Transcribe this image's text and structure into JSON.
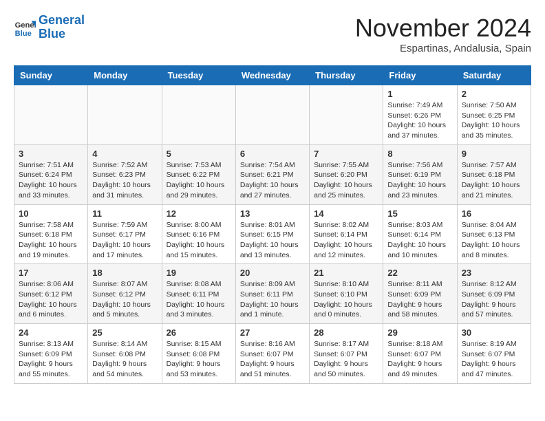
{
  "header": {
    "logo_line1": "General",
    "logo_line2": "Blue",
    "month": "November 2024",
    "location": "Espartinas, Andalusia, Spain"
  },
  "days_of_week": [
    "Sunday",
    "Monday",
    "Tuesday",
    "Wednesday",
    "Thursday",
    "Friday",
    "Saturday"
  ],
  "weeks": [
    [
      {
        "day": "",
        "info": ""
      },
      {
        "day": "",
        "info": ""
      },
      {
        "day": "",
        "info": ""
      },
      {
        "day": "",
        "info": ""
      },
      {
        "day": "",
        "info": ""
      },
      {
        "day": "1",
        "info": "Sunrise: 7:49 AM\nSunset: 6:26 PM\nDaylight: 10 hours and 37 minutes."
      },
      {
        "day": "2",
        "info": "Sunrise: 7:50 AM\nSunset: 6:25 PM\nDaylight: 10 hours and 35 minutes."
      }
    ],
    [
      {
        "day": "3",
        "info": "Sunrise: 7:51 AM\nSunset: 6:24 PM\nDaylight: 10 hours and 33 minutes."
      },
      {
        "day": "4",
        "info": "Sunrise: 7:52 AM\nSunset: 6:23 PM\nDaylight: 10 hours and 31 minutes."
      },
      {
        "day": "5",
        "info": "Sunrise: 7:53 AM\nSunset: 6:22 PM\nDaylight: 10 hours and 29 minutes."
      },
      {
        "day": "6",
        "info": "Sunrise: 7:54 AM\nSunset: 6:21 PM\nDaylight: 10 hours and 27 minutes."
      },
      {
        "day": "7",
        "info": "Sunrise: 7:55 AM\nSunset: 6:20 PM\nDaylight: 10 hours and 25 minutes."
      },
      {
        "day": "8",
        "info": "Sunrise: 7:56 AM\nSunset: 6:19 PM\nDaylight: 10 hours and 23 minutes."
      },
      {
        "day": "9",
        "info": "Sunrise: 7:57 AM\nSunset: 6:18 PM\nDaylight: 10 hours and 21 minutes."
      }
    ],
    [
      {
        "day": "10",
        "info": "Sunrise: 7:58 AM\nSunset: 6:18 PM\nDaylight: 10 hours and 19 minutes."
      },
      {
        "day": "11",
        "info": "Sunrise: 7:59 AM\nSunset: 6:17 PM\nDaylight: 10 hours and 17 minutes."
      },
      {
        "day": "12",
        "info": "Sunrise: 8:00 AM\nSunset: 6:16 PM\nDaylight: 10 hours and 15 minutes."
      },
      {
        "day": "13",
        "info": "Sunrise: 8:01 AM\nSunset: 6:15 PM\nDaylight: 10 hours and 13 minutes."
      },
      {
        "day": "14",
        "info": "Sunrise: 8:02 AM\nSunset: 6:14 PM\nDaylight: 10 hours and 12 minutes."
      },
      {
        "day": "15",
        "info": "Sunrise: 8:03 AM\nSunset: 6:14 PM\nDaylight: 10 hours and 10 minutes."
      },
      {
        "day": "16",
        "info": "Sunrise: 8:04 AM\nSunset: 6:13 PM\nDaylight: 10 hours and 8 minutes."
      }
    ],
    [
      {
        "day": "17",
        "info": "Sunrise: 8:06 AM\nSunset: 6:12 PM\nDaylight: 10 hours and 6 minutes."
      },
      {
        "day": "18",
        "info": "Sunrise: 8:07 AM\nSunset: 6:12 PM\nDaylight: 10 hours and 5 minutes."
      },
      {
        "day": "19",
        "info": "Sunrise: 8:08 AM\nSunset: 6:11 PM\nDaylight: 10 hours and 3 minutes."
      },
      {
        "day": "20",
        "info": "Sunrise: 8:09 AM\nSunset: 6:11 PM\nDaylight: 10 hours and 1 minute."
      },
      {
        "day": "21",
        "info": "Sunrise: 8:10 AM\nSunset: 6:10 PM\nDaylight: 10 hours and 0 minutes."
      },
      {
        "day": "22",
        "info": "Sunrise: 8:11 AM\nSunset: 6:09 PM\nDaylight: 9 hours and 58 minutes."
      },
      {
        "day": "23",
        "info": "Sunrise: 8:12 AM\nSunset: 6:09 PM\nDaylight: 9 hours and 57 minutes."
      }
    ],
    [
      {
        "day": "24",
        "info": "Sunrise: 8:13 AM\nSunset: 6:09 PM\nDaylight: 9 hours and 55 minutes."
      },
      {
        "day": "25",
        "info": "Sunrise: 8:14 AM\nSunset: 6:08 PM\nDaylight: 9 hours and 54 minutes."
      },
      {
        "day": "26",
        "info": "Sunrise: 8:15 AM\nSunset: 6:08 PM\nDaylight: 9 hours and 53 minutes."
      },
      {
        "day": "27",
        "info": "Sunrise: 8:16 AM\nSunset: 6:07 PM\nDaylight: 9 hours and 51 minutes."
      },
      {
        "day": "28",
        "info": "Sunrise: 8:17 AM\nSunset: 6:07 PM\nDaylight: 9 hours and 50 minutes."
      },
      {
        "day": "29",
        "info": "Sunrise: 8:18 AM\nSunset: 6:07 PM\nDaylight: 9 hours and 49 minutes."
      },
      {
        "day": "30",
        "info": "Sunrise: 8:19 AM\nSunset: 6:07 PM\nDaylight: 9 hours and 47 minutes."
      }
    ]
  ]
}
